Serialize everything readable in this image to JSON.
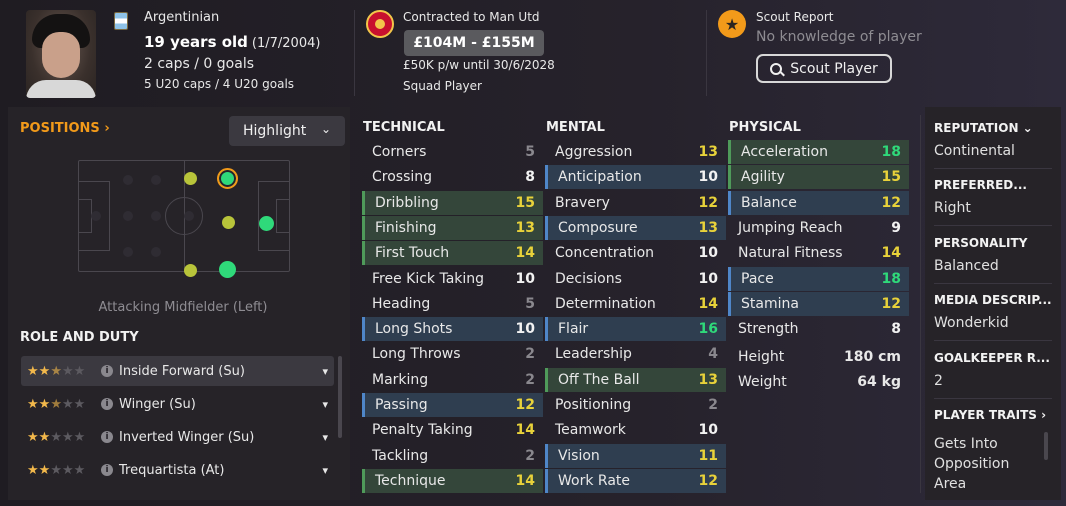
{
  "player": {
    "nationality": "Argentinian",
    "age_dob_main": "19 years old",
    "age_dob_date": "(1/7/2004)",
    "caps": "2 caps / 0 goals",
    "u20_caps": "5 U20 caps / 4 U20 goals"
  },
  "contract": {
    "club_line": "Contracted to Man Utd",
    "value": "£104M - £155M",
    "wage": "£50K p/w until 30/6/2028",
    "status": "Squad Player"
  },
  "scout": {
    "title": "Scout Report",
    "knowledge": "No knowledge of player",
    "button": "Scout Player"
  },
  "positions": {
    "title": "POSITIONS",
    "highlight_label": "Highlight",
    "caption": "Attacking Midfielder (Left)"
  },
  "role_duty": {
    "title": "ROLE AND DUTY",
    "roles": [
      {
        "label": "Inside Forward (Su)",
        "stars": 2.5
      },
      {
        "label": "Winger (Su)",
        "stars": 2.5
      },
      {
        "label": "Inverted Winger (Su)",
        "stars": 2
      },
      {
        "label": "Trequartista (At)",
        "stars": 2
      }
    ]
  },
  "technical": {
    "title": "TECHNICAL",
    "attrs": [
      {
        "name": "Corners",
        "value": "5",
        "hl": ""
      },
      {
        "name": "Crossing",
        "value": "8",
        "hl": ""
      },
      {
        "name": "Dribbling",
        "value": "15",
        "hl": "g"
      },
      {
        "name": "Finishing",
        "value": "13",
        "hl": "g"
      },
      {
        "name": "First Touch",
        "value": "14",
        "hl": "g"
      },
      {
        "name": "Free Kick Taking",
        "value": "10",
        "hl": ""
      },
      {
        "name": "Heading",
        "value": "5",
        "hl": ""
      },
      {
        "name": "Long Shots",
        "value": "10",
        "hl": "b"
      },
      {
        "name": "Long Throws",
        "value": "2",
        "hl": ""
      },
      {
        "name": "Marking",
        "value": "2",
        "hl": ""
      },
      {
        "name": "Passing",
        "value": "12",
        "hl": "b"
      },
      {
        "name": "Penalty Taking",
        "value": "14",
        "hl": ""
      },
      {
        "name": "Tackling",
        "value": "2",
        "hl": ""
      },
      {
        "name": "Technique",
        "value": "14",
        "hl": "g"
      }
    ]
  },
  "mental": {
    "title": "MENTAL",
    "attrs": [
      {
        "name": "Aggression",
        "value": "13",
        "hl": ""
      },
      {
        "name": "Anticipation",
        "value": "10",
        "hl": "b"
      },
      {
        "name": "Bravery",
        "value": "12",
        "hl": ""
      },
      {
        "name": "Composure",
        "value": "13",
        "hl": "b"
      },
      {
        "name": "Concentration",
        "value": "10",
        "hl": ""
      },
      {
        "name": "Decisions",
        "value": "10",
        "hl": ""
      },
      {
        "name": "Determination",
        "value": "14",
        "hl": ""
      },
      {
        "name": "Flair",
        "value": "16",
        "hl": "b"
      },
      {
        "name": "Leadership",
        "value": "4",
        "hl": ""
      },
      {
        "name": "Off The Ball",
        "value": "13",
        "hl": "g"
      },
      {
        "name": "Positioning",
        "value": "2",
        "hl": ""
      },
      {
        "name": "Teamwork",
        "value": "10",
        "hl": ""
      },
      {
        "name": "Vision",
        "value": "11",
        "hl": "b"
      },
      {
        "name": "Work Rate",
        "value": "12",
        "hl": "b"
      }
    ]
  },
  "physical": {
    "title": "PHYSICAL",
    "attrs": [
      {
        "name": "Acceleration",
        "value": "18",
        "hl": "g"
      },
      {
        "name": "Agility",
        "value": "15",
        "hl": "g"
      },
      {
        "name": "Balance",
        "value": "12",
        "hl": "b"
      },
      {
        "name": "Jumping Reach",
        "value": "9",
        "hl": ""
      },
      {
        "name": "Natural Fitness",
        "value": "14",
        "hl": ""
      },
      {
        "name": "Pace",
        "value": "18",
        "hl": "b"
      },
      {
        "name": "Stamina",
        "value": "12",
        "hl": "b"
      },
      {
        "name": "Strength",
        "value": "8",
        "hl": ""
      }
    ],
    "height_label": "Height",
    "height_value": "180 cm",
    "weight_label": "Weight",
    "weight_value": "64 kg"
  },
  "side": {
    "reputation_title": "REPUTATION",
    "reputation_value": "Continental",
    "preferred_title": "PREFERRED...",
    "preferred_value": "Right",
    "personality_title": "PERSONALITY",
    "personality_value": "Balanced",
    "media_title": "MEDIA DESCRIP...",
    "media_value": "Wonderkid",
    "gk_title": "GOALKEEPER R...",
    "gk_value": "2",
    "traits_title": "PLAYER TRAITS",
    "traits_value": "Gets Into Opposition Area"
  },
  "colors": {
    "accent": "#f29a1a",
    "high": "#2fd97a",
    "good": "#e8d23a"
  }
}
